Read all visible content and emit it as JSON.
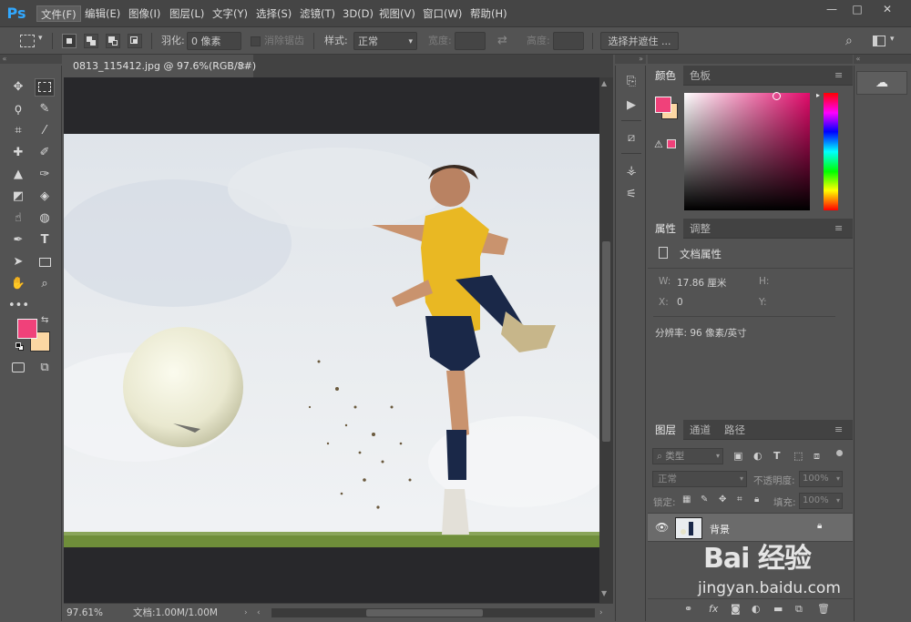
{
  "app": {
    "logo": "Ps"
  },
  "menu": [
    "文件(F)",
    "编辑(E)",
    "图像(I)",
    "图层(L)",
    "文字(Y)",
    "选择(S)",
    "滤镜(T)",
    "3D(D)",
    "视图(V)",
    "窗口(W)",
    "帮助(H)"
  ],
  "window_buttons": [
    "—",
    "□",
    "✕"
  ],
  "options": {
    "feather_label": "羽化:",
    "feather_value": "0 像素",
    "antialias_label": "消除锯齿",
    "style_label": "样式:",
    "style_value": "正常",
    "width_label": "宽度:",
    "height_label": "高度:",
    "select_mask_button": "选择并遮住 ..."
  },
  "document": {
    "tab_title": "0813_115412.jpg @ 97.6%(RGB/8#)",
    "tab_close": "×",
    "zoom": "97.61%",
    "doc_info": "文档:1.00M/1.00M"
  },
  "color_panel": {
    "tabs": [
      "颜色",
      "色板"
    ],
    "foreground": "#f0417a",
    "background": "#fcd7a3"
  },
  "properties_panel": {
    "tabs": [
      "属性",
      "调整"
    ],
    "title": "文档属性",
    "w_label": "W:",
    "w_value": "17.86 厘米",
    "h_label": "H:",
    "x_label": "X:",
    "x_value": "0",
    "y_label": "Y:",
    "resolution": "分辨率: 96 像素/英寸"
  },
  "layers_panel": {
    "tabs": [
      "图层",
      "通道",
      "路径"
    ],
    "filter_label": "类型",
    "blend_mode": "正常",
    "opacity_label": "不透明度:",
    "opacity_value": "100%",
    "lock_label": "锁定:",
    "fill_label": "填充:",
    "fill_value": "100%",
    "layers": [
      {
        "name": "背景"
      }
    ],
    "footer_icons": [
      "link-icon",
      "fx-icon",
      "mask-icon",
      "adjustment-icon",
      "folder-icon",
      "new-layer-icon",
      "trash-icon"
    ]
  },
  "watermark": {
    "brand": "Bai 经验",
    "url": "jingyan.baidu.com"
  },
  "colors": {
    "accent": "#31a8ff",
    "foreground": "#f0417a",
    "background": "#fcd7a3"
  }
}
